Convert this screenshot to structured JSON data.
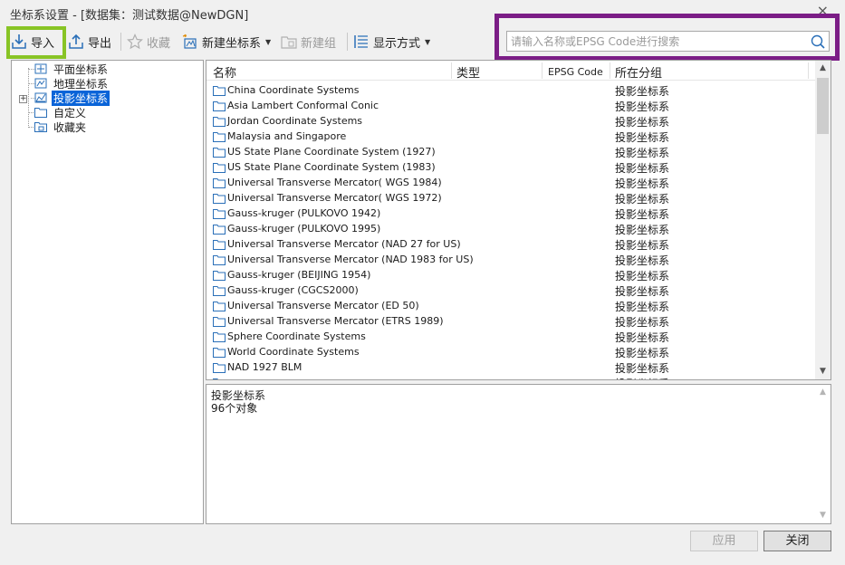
{
  "window": {
    "title": "坐标系设置 - [数据集：测试数据@NewDGN]",
    "close_glyph": "×"
  },
  "toolbar": {
    "import_label": "导入",
    "export_label": "导出",
    "favorite_label": "收藏",
    "new_crs_label": "新建坐标系",
    "new_group_label": "新建组",
    "display_mode_label": "显示方式"
  },
  "search": {
    "placeholder": "请输入名称或EPSG Code进行搜索",
    "value": ""
  },
  "tree": {
    "items": [
      {
        "label": "平面坐标系",
        "icon": "planar-crs-icon"
      },
      {
        "label": "地理坐标系",
        "icon": "geographic-crs-icon"
      },
      {
        "label": "投影坐标系",
        "icon": "projected-crs-icon",
        "selected": true
      },
      {
        "label": "自定义",
        "icon": "folder-icon"
      },
      {
        "label": "收藏夹",
        "icon": "favorites-folder-icon"
      }
    ]
  },
  "list": {
    "columns": [
      "名称",
      "类型",
      "EPSG Code",
      "所在分组"
    ],
    "rows": [
      {
        "name": "China Coordinate Systems",
        "group": "投影坐标系"
      },
      {
        "name": "Asia Lambert Conformal Conic",
        "group": "投影坐标系"
      },
      {
        "name": "Jordan Coordinate Systems",
        "group": "投影坐标系"
      },
      {
        "name": "Malaysia and Singapore",
        "group": "投影坐标系"
      },
      {
        "name": "US State Plane Coordinate System (1927)",
        "group": "投影坐标系"
      },
      {
        "name": "US State Plane Coordinate System (1983)",
        "group": "投影坐标系"
      },
      {
        "name": "Universal Transverse Mercator( WGS 1984)",
        "group": "投影坐标系"
      },
      {
        "name": "Universal Transverse Mercator( WGS 1972)",
        "group": "投影坐标系"
      },
      {
        "name": "Gauss-kruger (PULKOVO 1942)",
        "group": "投影坐标系"
      },
      {
        "name": "Gauss-kruger (PULKOVO 1995)",
        "group": "投影坐标系"
      },
      {
        "name": "Universal Transverse Mercator (NAD 27 for US)",
        "group": "投影坐标系"
      },
      {
        "name": "Universal Transverse Mercator (NAD 1983 for US)",
        "group": "投影坐标系"
      },
      {
        "name": "Gauss-kruger (BEIJING 1954)",
        "group": "投影坐标系"
      },
      {
        "name": "Gauss-kruger (CGCS2000)",
        "group": "投影坐标系"
      },
      {
        "name": "Universal Transverse Mercator (ED 50)",
        "group": "投影坐标系"
      },
      {
        "name": "Universal Transverse Mercator (ETRS 1989)",
        "group": "投影坐标系"
      },
      {
        "name": "Sphere Coordinate Systems",
        "group": "投影坐标系"
      },
      {
        "name": "World Coordinate Systems",
        "group": "投影坐标系"
      },
      {
        "name": "NAD 1927 BLM",
        "group": "投影坐标系"
      },
      {
        "name": "",
        "group": "投影坐标系"
      }
    ]
  },
  "info": {
    "line1": "投影坐标系",
    "line2": "96个对象"
  },
  "buttons": {
    "apply_label": "应用",
    "close_label": "关闭"
  },
  "colors": {
    "highlight_green": "#88c425",
    "highlight_purple": "#7b1d86",
    "selection_blue": "#0a64d8"
  }
}
